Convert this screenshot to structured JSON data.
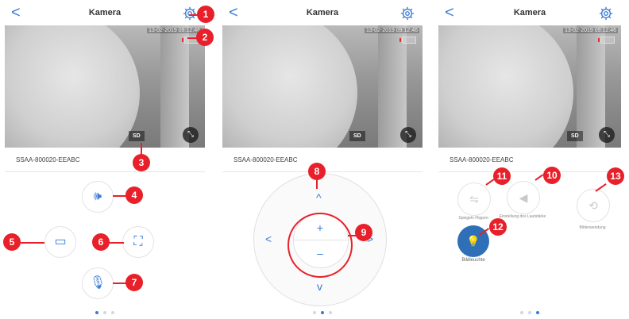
{
  "screens": [
    {
      "header": {
        "back": "<",
        "title": "Kamera"
      },
      "video": {
        "timestamp": "13-02-2019 09:12:46",
        "quality": "SD"
      },
      "device_id": "SSAA-800020-EEABC"
    },
    {
      "header": {
        "back": "<",
        "title": "Kamera"
      },
      "video": {
        "timestamp": "13-02-2019 09:12:46",
        "quality": "SD"
      },
      "device_id": "SSAA-800020-EEABC"
    },
    {
      "header": {
        "back": "<",
        "title": "Kamera"
      },
      "video": {
        "timestamp": "13-02-2019 09:12:46",
        "quality": "SD"
      },
      "device_id": "SSAA-800020-EEABC"
    }
  ],
  "markers": [
    "1",
    "2",
    "3",
    "4",
    "5",
    "6",
    "7",
    "8",
    "9",
    "10",
    "11",
    "12",
    "13"
  ],
  "ptz": {
    "up": "^",
    "down": "v",
    "left": "<",
    "right": ">",
    "plus": "+",
    "minus": "–"
  },
  "function_labels": {
    "label1": "Spiegeln Flippen",
    "label2": "Einstellung des Lautstärke",
    "label3": "Bilderwendung",
    "label4": "Bildleuchte"
  },
  "colors": {
    "accent": "#3a7bd5",
    "marker": "#e8202a",
    "light_button": "#2f6fb8"
  },
  "icons": [
    "gear-icon",
    "back-arrow-icon",
    "fullscreen-icon",
    "speaker-icon",
    "record-video-icon",
    "snapshot-icon",
    "microphone-icon",
    "flip-icon",
    "volume-icon",
    "rotate-icon",
    "light-icon"
  ]
}
